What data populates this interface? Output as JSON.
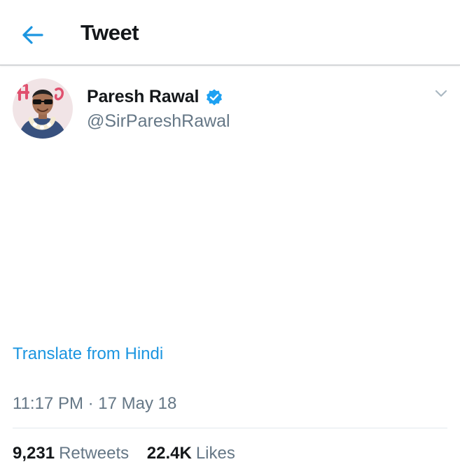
{
  "header": {
    "back_icon": "arrow-left-icon",
    "title": "Tweet"
  },
  "tweet": {
    "author": {
      "name": "Paresh Rawal",
      "handle": "@SirPareshRawal",
      "verified": true,
      "verified_icon": "verified-badge-icon"
    },
    "menu_icon": "chevron-down-icon",
    "translate_link": "Translate from Hindi",
    "timestamp": "11:17 PM · 17 May 18",
    "stats": {
      "retweets_count": "9,231",
      "retweets_label": "Retweets",
      "likes_count": "22.4K",
      "likes_label": "Likes"
    }
  },
  "colors": {
    "accent": "#1b95e0",
    "secondary_text": "#657786",
    "primary_text": "#14171a"
  }
}
